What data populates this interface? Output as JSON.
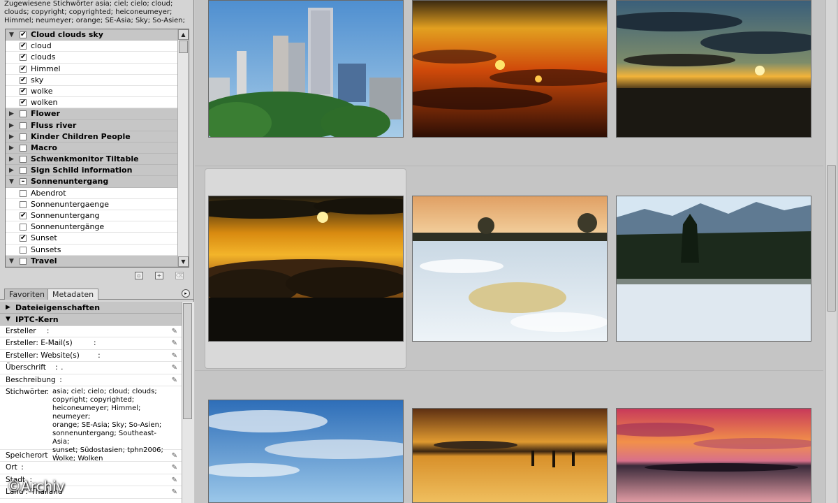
{
  "assigned_keywords": {
    "text": "Zugewiesene Stichwörter asia; ciel; cielo; cloud; clouds; copyright; copyrighted; heiconeumeyer; Himmel; neumeyer; orange; SE-Asia; Sky; So-Asien;"
  },
  "keywords": [
    {
      "label": "Cloud clouds sky",
      "type": "parent",
      "expanded": true,
      "check": "on"
    },
    {
      "label": "cloud",
      "type": "child",
      "check": "on"
    },
    {
      "label": "clouds",
      "type": "child",
      "check": "on"
    },
    {
      "label": "Himmel",
      "type": "child",
      "check": "on"
    },
    {
      "label": "sky",
      "type": "child",
      "check": "on"
    },
    {
      "label": "wolke",
      "type": "child",
      "check": "on"
    },
    {
      "label": "wolken",
      "type": "child",
      "check": "on"
    },
    {
      "label": "Flower",
      "type": "parent",
      "expanded": false,
      "check": "off"
    },
    {
      "label": "Fluss river",
      "type": "parent",
      "expanded": false,
      "check": "off"
    },
    {
      "label": "Kinder Children People",
      "type": "parent",
      "expanded": false,
      "check": "off"
    },
    {
      "label": "Macro",
      "type": "parent",
      "expanded": false,
      "check": "off"
    },
    {
      "label": "Schwenkmonitor Tiltable",
      "type": "parent",
      "expanded": false,
      "check": "off"
    },
    {
      "label": "Sign Schild information",
      "type": "parent",
      "expanded": false,
      "check": "off"
    },
    {
      "label": "Sonnenuntergang",
      "type": "parent",
      "expanded": true,
      "check": "partial"
    },
    {
      "label": "Abendrot",
      "type": "child",
      "check": "off"
    },
    {
      "label": "Sonnenuntergaenge",
      "type": "child",
      "check": "off"
    },
    {
      "label": "Sonnenuntergang",
      "type": "child",
      "check": "on"
    },
    {
      "label": "Sonnenuntergänge",
      "type": "child",
      "check": "off"
    },
    {
      "label": "Sunset",
      "type": "child",
      "check": "on"
    },
    {
      "label": "Sunsets",
      "type": "child",
      "check": "off"
    },
    {
      "label": "Travel",
      "type": "parent",
      "expanded": true,
      "check": "off"
    }
  ],
  "tabs": [
    {
      "label": "Favoriten",
      "active": false
    },
    {
      "label": "Metadaten",
      "active": true
    }
  ],
  "metadata": {
    "section_file": "Dateieigenschaften",
    "section_iptc": "IPTC-Kern",
    "fields": [
      {
        "label": "Ersteller",
        "value": ""
      },
      {
        "label": "Ersteller: E-Mail(s)",
        "value": ""
      },
      {
        "label": "Ersteller: Website(s)",
        "value": ""
      },
      {
        "label": "Überschrift",
        "value": "."
      },
      {
        "label": "Beschreibung",
        "value": ""
      }
    ],
    "keywords_field": {
      "label": "Stichwörter",
      "lines": [
        "asia; ciel; cielo; cloud; clouds;",
        "copyright; copyrighted;",
        "heiconeumeyer; Himmel; neumeyer;",
        "orange; SE-Asia; Sky; So-Asien;",
        "sonnenuntergang; Southeast-Asia;",
        "sunset; Südostasien; tphn2006;",
        "Wolke; Wolken"
      ]
    },
    "fields_after": [
      {
        "label": "Speicherort",
        "value": ""
      },
      {
        "label": "Ort",
        "value": ""
      },
      {
        "label": "Stadt",
        "value": ""
      },
      {
        "label": "Land",
        "value": "Thailand"
      }
    ]
  },
  "watermark": "©Archiv",
  "colors": {
    "accent": "#c6c6c6",
    "panel": "#d4d4d4",
    "content_bg": "#c5c5c5"
  },
  "thumbnails": [
    {
      "name": "city-skyline",
      "row": 0,
      "col": 0
    },
    {
      "name": "sunset-clouds-orange",
      "row": 0,
      "col": 1
    },
    {
      "name": "sunset-dark-clouds",
      "row": 0,
      "col": 2
    },
    {
      "name": "sunset-above-clouds",
      "row": 1,
      "col": 0,
      "selected": true
    },
    {
      "name": "snowy-field-dusk",
      "row": 1,
      "col": 1
    },
    {
      "name": "snowy-mountain-forest",
      "row": 1,
      "col": 2
    },
    {
      "name": "blue-sky-clouds",
      "row": 2,
      "col": 0
    },
    {
      "name": "people-in-sea-sunset",
      "row": 2,
      "col": 1
    },
    {
      "name": "pink-sunset-island",
      "row": 2,
      "col": 2
    }
  ]
}
